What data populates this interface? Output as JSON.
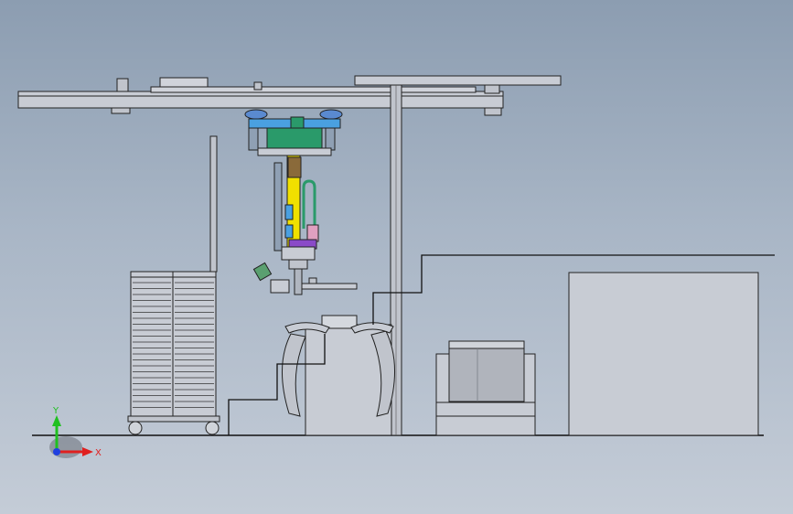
{
  "view": {
    "background_top": "#8c9db1",
    "background_bottom": "#c4ccd7",
    "line_color": "#222222",
    "part_fill": "#b9bec8"
  },
  "triad": {
    "x_label": "X",
    "y_label": "Y",
    "x_color": "#e02020",
    "y_color": "#20c020",
    "z_color": "#2040e0"
  },
  "colors": {
    "yellow_column": "#f0e000",
    "green_motor": "#2a9a6a",
    "blue_carriage": "#4aa0e0",
    "purple_block": "#8a4ac8"
  }
}
